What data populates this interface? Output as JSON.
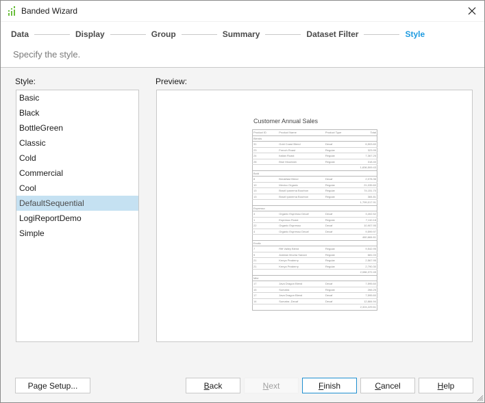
{
  "window": {
    "title": "Banded Wizard",
    "icon": "wizard-bars-icon",
    "close_icon": "close-icon"
  },
  "steps": [
    {
      "label": "Data",
      "active": false
    },
    {
      "label": "Display",
      "active": false
    },
    {
      "label": "Group",
      "active": false
    },
    {
      "label": "Summary",
      "active": false
    },
    {
      "label": "Dataset Filter",
      "active": false
    },
    {
      "label": "Style",
      "active": true
    }
  ],
  "subtitle": "Specify the style.",
  "style_panel": {
    "label": "Style:",
    "items": [
      "Basic",
      "Black",
      "BottleGreen",
      "Classic",
      "Cold",
      "Commercial",
      "Cool",
      "DefaultSequential",
      "LogiReportDemo",
      "Simple"
    ],
    "selected": "DefaultSequential"
  },
  "preview_panel": {
    "label": "Preview:",
    "report": {
      "title": "Customer Annual Sales",
      "columns": [
        "Product ID",
        "Product Name",
        "Product Type",
        "Total"
      ],
      "groups": [
        {
          "name": "Blends",
          "rows": [
            [
              "31",
              "Gold Coast Blend",
              "Decaf",
              "6,503.60"
            ],
            [
              "23",
              "French Roast",
              "Regular",
              "323.95"
            ],
            [
              "24",
              "Italian Roast",
              "Regular",
              "7,367.25"
            ],
            [
              "28",
              "Blue Mountain",
              "Regular",
              "318.40"
            ]
          ],
          "subtotal": "1,836,509.43"
        },
        {
          "name": "Bold",
          "rows": [
            [
              "8",
              "Breakfast Blend",
              "Decaf",
              "2,078.36"
            ],
            [
              "10",
              "Mexico Organic",
              "Regular",
              "21,035.60"
            ],
            [
              "13",
              "Brazil Ipanema Bourbon",
              "Regular",
              "74,151.70"
            ],
            [
              "13",
              "Brazil Ipanema Bourbon",
              "Regular",
              "384.81"
            ]
          ],
          "subtotal": "1,799,017.91"
        },
        {
          "name": "Espresso",
          "rows": [
            [
              "4",
              "Organic Espresso Decaf",
              "Decaf",
              "3,402.52"
            ],
            [
              "1",
              "Espresso Roast",
              "Regular",
              "7,110.18"
            ],
            [
              "22",
              "Organic Espresso",
              "Decaf",
              "10,907.95"
            ],
            [
              "4",
              "Organic Espresso Decaf",
              "Decaf",
              "9,599.97"
            ]
          ],
          "subtotal": "460,684.61"
        },
        {
          "name": "Exotic",
          "rows": [
            [
              "7",
              "Rift Valley Blend",
              "Regular",
              "9,542.95"
            ],
            [
              "5",
              "Arabian Mocha Sanani",
              "Regular",
              "681.03"
            ],
            [
              "21",
              "Kenya Peaberry",
              "Regular",
              "2,567.95"
            ],
            [
              "21",
              "Kenya Peaberry",
              "Regular",
              "2,790.30"
            ]
          ],
          "subtotal": "2,086,372.45"
        },
        {
          "name": "Mild",
          "rows": [
            [
              "17",
              "Java Dragon Blend",
              "Decaf",
              "7,595.60"
            ],
            [
              "15",
              "Sumatra",
              "Regular",
              "266.25"
            ],
            [
              "17",
              "Java Dragon Blend",
              "Decaf",
              "7,595.60"
            ],
            [
              "14",
              "Sumatra -Decaf",
              "Decaf",
              "12,884.94"
            ]
          ],
          "subtotal": "2,324,229.61"
        }
      ]
    }
  },
  "buttons": {
    "page_setup": "Page Setup...",
    "back": "Back",
    "next": "Next",
    "finish": "Finish",
    "cancel": "Cancel",
    "help": "Help"
  },
  "colors": {
    "accent": "#1e9be0",
    "selection": "#c5e1f2",
    "icon_green": "#6cbf3f"
  }
}
